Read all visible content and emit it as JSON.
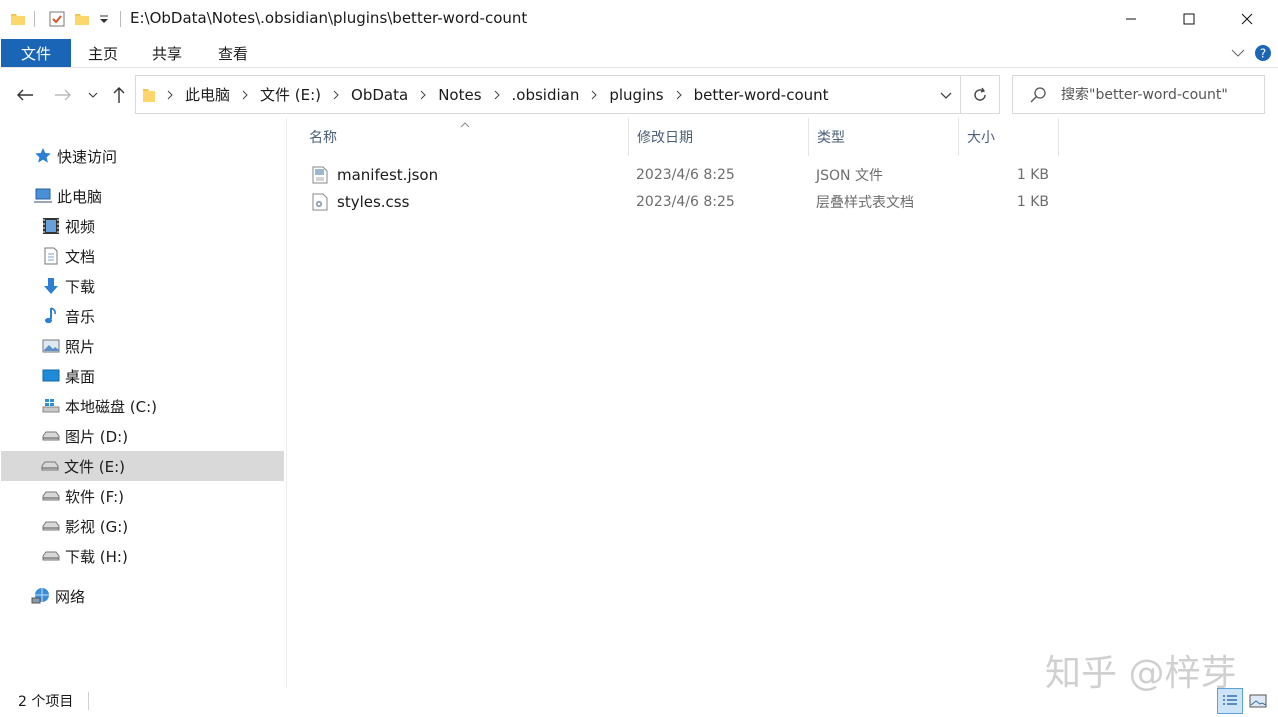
{
  "window": {
    "title": "E:\\ObData\\Notes\\.obsidian\\plugins\\better-word-count"
  },
  "ribbon": {
    "file_tab": "文件",
    "tabs": [
      "主页",
      "共享",
      "查看"
    ]
  },
  "address": {
    "crumbs": [
      "此电脑",
      "文件 (E:)",
      "ObData",
      "Notes",
      ".obsidian",
      "plugins",
      "better-word-count"
    ]
  },
  "search": {
    "placeholder": "搜索\"better-word-count\""
  },
  "nav": {
    "items": [
      {
        "label": "快速访问",
        "icon": "star-icon"
      },
      {
        "label": "此电脑",
        "icon": "computer-icon"
      },
      {
        "label": "视频",
        "icon": "video-icon"
      },
      {
        "label": "文档",
        "icon": "document-icon"
      },
      {
        "label": "下载",
        "icon": "download-icon"
      },
      {
        "label": "音乐",
        "icon": "music-icon"
      },
      {
        "label": "照片",
        "icon": "picture-icon"
      },
      {
        "label": "桌面",
        "icon": "desktop-icon"
      },
      {
        "label": "本地磁盘 (C:)",
        "icon": "windows-drive-icon"
      },
      {
        "label": "图片 (D:)",
        "icon": "drive-icon"
      },
      {
        "label": "文件 (E:)",
        "icon": "drive-icon",
        "selected": true
      },
      {
        "label": "软件 (F:)",
        "icon": "drive-icon"
      },
      {
        "label": "影视 (G:)",
        "icon": "drive-icon"
      },
      {
        "label": "下载 (H:)",
        "icon": "drive-icon"
      },
      {
        "label": "网络",
        "icon": "network-icon"
      }
    ]
  },
  "files": {
    "columns": [
      "名称",
      "修改日期",
      "类型",
      "大小"
    ],
    "rows": [
      {
        "name": "manifest.json",
        "modified": "2023/4/6 8:25",
        "type": "JSON 文件",
        "size": "1 KB",
        "icon": "json-file-icon"
      },
      {
        "name": "styles.css",
        "modified": "2023/4/6 8:25",
        "type": "层叠样式表文档",
        "size": "1 KB",
        "icon": "css-file-icon"
      }
    ]
  },
  "status": {
    "count": "2 个项目"
  },
  "watermark": "知乎 @梓芽",
  "colors": {
    "accent": "#1a65b5",
    "selection": "#d9d9d9",
    "header_text": "#4c607a"
  }
}
